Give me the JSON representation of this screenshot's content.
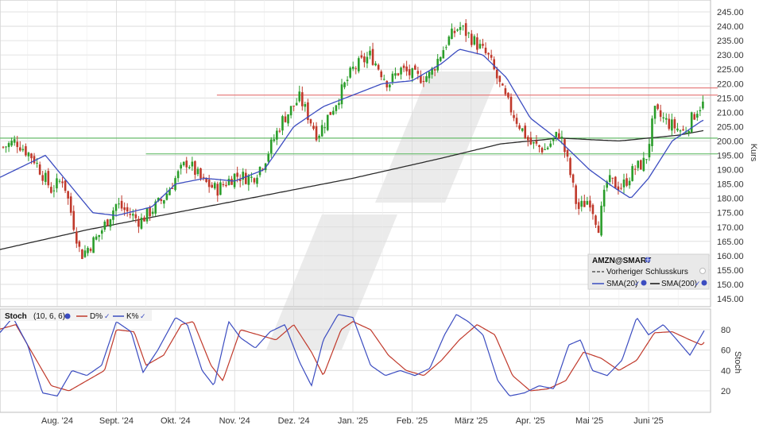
{
  "colors": {
    "up": "#2a9d2a",
    "down": "#c0392b",
    "sma20": "#3b4cc0",
    "sma200": "#2b2b2b",
    "resistance": "#e57373",
    "support": "#66bb6a",
    "grid": "#d9d9d9",
    "stoch_d": "#c0392b",
    "stoch_k": "#3b4cc0",
    "watermark": "#e6e6e6"
  },
  "legend": {
    "ticker": "AMZN@SMART",
    "prev_close": "Vorheriger Schlusskurs",
    "sma20": "SMA(20)",
    "sma200": "SMA(200)"
  },
  "stoch_header": {
    "title": "Stoch",
    "params": "(10, 6, 6)",
    "d_label": "D%",
    "k_label": "K%"
  },
  "chart_data": [
    {
      "type": "candlestick",
      "ylabel": "Kurs",
      "ylim": [
        141,
        247
      ],
      "yticks": [
        145,
        150,
        155,
        160,
        165,
        170,
        175,
        180,
        185,
        190,
        195,
        200,
        205,
        210,
        215,
        220,
        225,
        230,
        235,
        240,
        245
      ],
      "x_month_labels": [
        "Aug. '24",
        "Sept. '24",
        "Okt. '24",
        "Nov. '24",
        "Dez. '24",
        "Jan. '25",
        "Feb. '25",
        "März '25",
        "Apr. '25",
        "Mai '25",
        "Juni '25"
      ],
      "grid": true,
      "legend_position": "bottom-right",
      "horizontal_lines": {
        "resistance": [
          {
            "value": 218.5,
            "from_month": 9.5
          },
          {
            "value": 216,
            "from_month": 3.7
          }
        ],
        "support": [
          {
            "value": 201,
            "from_month": 0
          },
          {
            "value": 195.5,
            "from_month": 2.5
          }
        ]
      },
      "close_anchors": [
        [
          0,
          197
        ],
        [
          0.3,
          200
        ],
        [
          0.6,
          194
        ],
        [
          0.9,
          183
        ],
        [
          1.1,
          187
        ],
        [
          1.4,
          160
        ],
        [
          1.7,
          167
        ],
        [
          2.0,
          178
        ],
        [
          2.4,
          172
        ],
        [
          2.8,
          180
        ],
        [
          3.0,
          187
        ],
        [
          3.2,
          193
        ],
        [
          3.45,
          186
        ],
        [
          3.7,
          183
        ],
        [
          4.0,
          188
        ],
        [
          4.3,
          187
        ],
        [
          4.5,
          193
        ],
        [
          4.8,
          207
        ],
        [
          5.1,
          215
        ],
        [
          5.4,
          202
        ],
        [
          5.7,
          213
        ],
        [
          6.0,
          225
        ],
        [
          6.3,
          230
        ],
        [
          6.6,
          220
        ],
        [
          6.8,
          225
        ],
        [
          7.1,
          222
        ],
        [
          7.3,
          223
        ],
        [
          7.6,
          235
        ],
        [
          7.8,
          240
        ],
        [
          8.0,
          236
        ],
        [
          8.3,
          229
        ],
        [
          8.55,
          216
        ],
        [
          8.75,
          208
        ],
        [
          9.0,
          199
        ],
        [
          9.25,
          197
        ],
        [
          9.5,
          203
        ],
        [
          9.65,
          191
        ],
        [
          9.8,
          176
        ],
        [
          10.0,
          180
        ],
        [
          10.15,
          170
        ],
        [
          10.3,
          186
        ],
        [
          10.55,
          184
        ],
        [
          10.75,
          190
        ],
        [
          10.95,
          193
        ],
        [
          11.1,
          210
        ],
        [
          11.35,
          206
        ],
        [
          11.6,
          203
        ],
        [
          11.85,
          212
        ],
        [
          12.05,
          214
        ],
        [
          12.3,
          217
        ]
      ],
      "sma20_anchors": [
        [
          0,
          187
        ],
        [
          0.8,
          195
        ],
        [
          1.2,
          185
        ],
        [
          1.6,
          175
        ],
        [
          2.0,
          174
        ],
        [
          2.6,
          177
        ],
        [
          3.0,
          185
        ],
        [
          3.5,
          187
        ],
        [
          4.0,
          186
        ],
        [
          4.5,
          190
        ],
        [
          5.0,
          205
        ],
        [
          5.5,
          212
        ],
        [
          6.0,
          216
        ],
        [
          6.5,
          220
        ],
        [
          7.0,
          221
        ],
        [
          7.5,
          227
        ],
        [
          7.8,
          232
        ],
        [
          8.2,
          230
        ],
        [
          8.6,
          222
        ],
        [
          9.0,
          208
        ],
        [
          9.5,
          200
        ],
        [
          10.0,
          190
        ],
        [
          10.4,
          184
        ],
        [
          10.7,
          180
        ],
        [
          11.0,
          187
        ],
        [
          11.4,
          200
        ],
        [
          11.9,
          207
        ],
        [
          12.3,
          210
        ]
      ],
      "sma200_anchors": [
        [
          0,
          162
        ],
        [
          1.5,
          169
        ],
        [
          3.0,
          175
        ],
        [
          4.5,
          181
        ],
        [
          6.0,
          187
        ],
        [
          7.5,
          194
        ],
        [
          8.5,
          199
        ],
        [
          9.5,
          201
        ],
        [
          10.5,
          200
        ],
        [
          11.5,
          202
        ],
        [
          12.3,
          205
        ]
      ]
    },
    {
      "type": "line",
      "title": "Stoch",
      "ylabel": "Stoch",
      "ylim": [
        0,
        100
      ],
      "yticks": [
        20,
        40,
        60,
        80
      ],
      "series": [
        {
          "name": "D%",
          "anchors": [
            [
              0,
              80
            ],
            [
              0.3,
              85
            ],
            [
              0.6,
              55
            ],
            [
              0.9,
              25
            ],
            [
              1.2,
              20
            ],
            [
              1.5,
              30
            ],
            [
              1.8,
              40
            ],
            [
              2.0,
              80
            ],
            [
              2.3,
              78
            ],
            [
              2.5,
              45
            ],
            [
              2.8,
              55
            ],
            [
              3.1,
              85
            ],
            [
              3.3,
              88
            ],
            [
              3.6,
              45
            ],
            [
              3.8,
              30
            ],
            [
              4.1,
              80
            ],
            [
              4.4,
              75
            ],
            [
              4.7,
              70
            ],
            [
              5.0,
              85
            ],
            [
              5.3,
              58
            ],
            [
              5.5,
              35
            ],
            [
              5.8,
              80
            ],
            [
              6.0,
              88
            ],
            [
              6.3,
              80
            ],
            [
              6.6,
              55
            ],
            [
              6.9,
              40
            ],
            [
              7.2,
              35
            ],
            [
              7.5,
              50
            ],
            [
              7.8,
              70
            ],
            [
              8.1,
              85
            ],
            [
              8.4,
              75
            ],
            [
              8.7,
              35
            ],
            [
              9.0,
              20
            ],
            [
              9.3,
              22
            ],
            [
              9.6,
              30
            ],
            [
              9.9,
              58
            ],
            [
              10.2,
              52
            ],
            [
              10.5,
              40
            ],
            [
              10.8,
              50
            ],
            [
              11.1,
              77
            ],
            [
              11.4,
              78
            ],
            [
              11.7,
              70
            ],
            [
              11.9,
              65
            ],
            [
              12.1,
              78
            ],
            [
              12.3,
              50
            ]
          ]
        },
        {
          "name": "K%",
          "anchors": [
            [
              0,
              75
            ],
            [
              0.25,
              92
            ],
            [
              0.5,
              65
            ],
            [
              0.75,
              18
            ],
            [
              1.0,
              15
            ],
            [
              1.25,
              40
            ],
            [
              1.5,
              35
            ],
            [
              1.75,
              45
            ],
            [
              2.0,
              88
            ],
            [
              2.25,
              78
            ],
            [
              2.45,
              38
            ],
            [
              2.7,
              60
            ],
            [
              3.0,
              92
            ],
            [
              3.2,
              85
            ],
            [
              3.45,
              40
            ],
            [
              3.65,
              25
            ],
            [
              3.9,
              88
            ],
            [
              4.1,
              72
            ],
            [
              4.35,
              62
            ],
            [
              4.6,
              78
            ],
            [
              4.85,
              85
            ],
            [
              5.1,
              48
            ],
            [
              5.3,
              25
            ],
            [
              5.5,
              70
            ],
            [
              5.75,
              95
            ],
            [
              6.0,
              92
            ],
            [
              6.3,
              45
            ],
            [
              6.55,
              35
            ],
            [
              6.8,
              40
            ],
            [
              7.05,
              35
            ],
            [
              7.3,
              42
            ],
            [
              7.55,
              75
            ],
            [
              7.75,
              95
            ],
            [
              7.95,
              88
            ],
            [
              8.2,
              75
            ],
            [
              8.45,
              30
            ],
            [
              8.65,
              15
            ],
            [
              8.9,
              18
            ],
            [
              9.15,
              25
            ],
            [
              9.4,
              22
            ],
            [
              9.65,
              65
            ],
            [
              9.85,
              70
            ],
            [
              10.05,
              40
            ],
            [
              10.3,
              35
            ],
            [
              10.55,
              50
            ],
            [
              10.8,
              92
            ],
            [
              11.0,
              75
            ],
            [
              11.25,
              85
            ],
            [
              11.45,
              72
            ],
            [
              11.7,
              55
            ],
            [
              11.95,
              80
            ],
            [
              12.15,
              85
            ],
            [
              12.3,
              40
            ]
          ]
        }
      ]
    }
  ]
}
